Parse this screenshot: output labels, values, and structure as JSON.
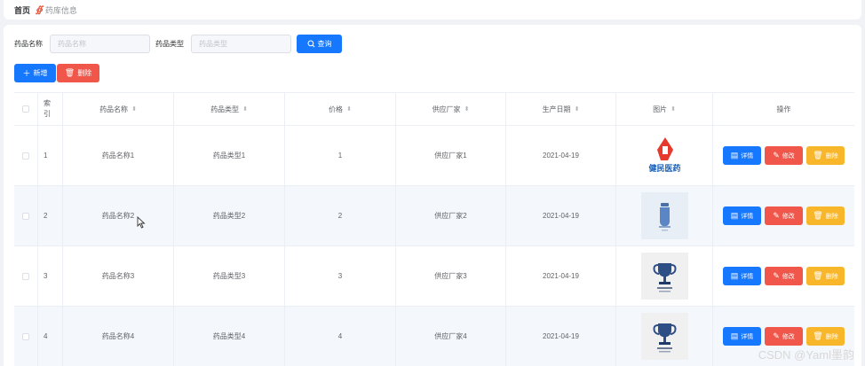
{
  "breadcrumb": {
    "home": "首页",
    "separator": "∯",
    "current": "药库信息"
  },
  "search": {
    "name_label": "药品名称",
    "name_placeholder": "药品名称",
    "type_label": "药品类型",
    "type_placeholder": "药品类型",
    "search_button": "查询"
  },
  "toolbar": {
    "add_label": "新增",
    "delete_label": "删除"
  },
  "table": {
    "headers": {
      "index": "索引",
      "name": "药品名称",
      "type": "药品类型",
      "price": "价格",
      "supplier": "供应厂家",
      "date": "生产日期",
      "image": "图片",
      "operation": "操作"
    },
    "rows": [
      {
        "index": "1",
        "name": "药品名称1",
        "type": "药品类型1",
        "price": "1",
        "supplier": "供应厂家1",
        "date": "2021-04-19",
        "image_label": "健民医药",
        "image_icon": "pharmacy-logo-icon"
      },
      {
        "index": "2",
        "name": "药品名称2",
        "type": "药品类型2",
        "price": "2",
        "supplier": "供应厂家2",
        "date": "2021-04-19",
        "image_icon": "bottle-icon"
      },
      {
        "index": "3",
        "name": "药品名称3",
        "type": "药品类型3",
        "price": "3",
        "supplier": "供应厂家3",
        "date": "2021-04-19",
        "image_icon": "trophy-icon"
      },
      {
        "index": "4",
        "name": "药品名称4",
        "type": "药品类型4",
        "price": "4",
        "supplier": "供应厂家4",
        "date": "2021-04-19",
        "image_icon": "trophy-icon"
      }
    ],
    "row_actions": {
      "detail": "详情",
      "edit": "修改",
      "remove": "删除"
    }
  },
  "watermark": "CSDN @Yaml墨韵",
  "colors": {
    "primary": "#1677ff",
    "danger": "#f0564a",
    "warning": "#f8b62b"
  }
}
